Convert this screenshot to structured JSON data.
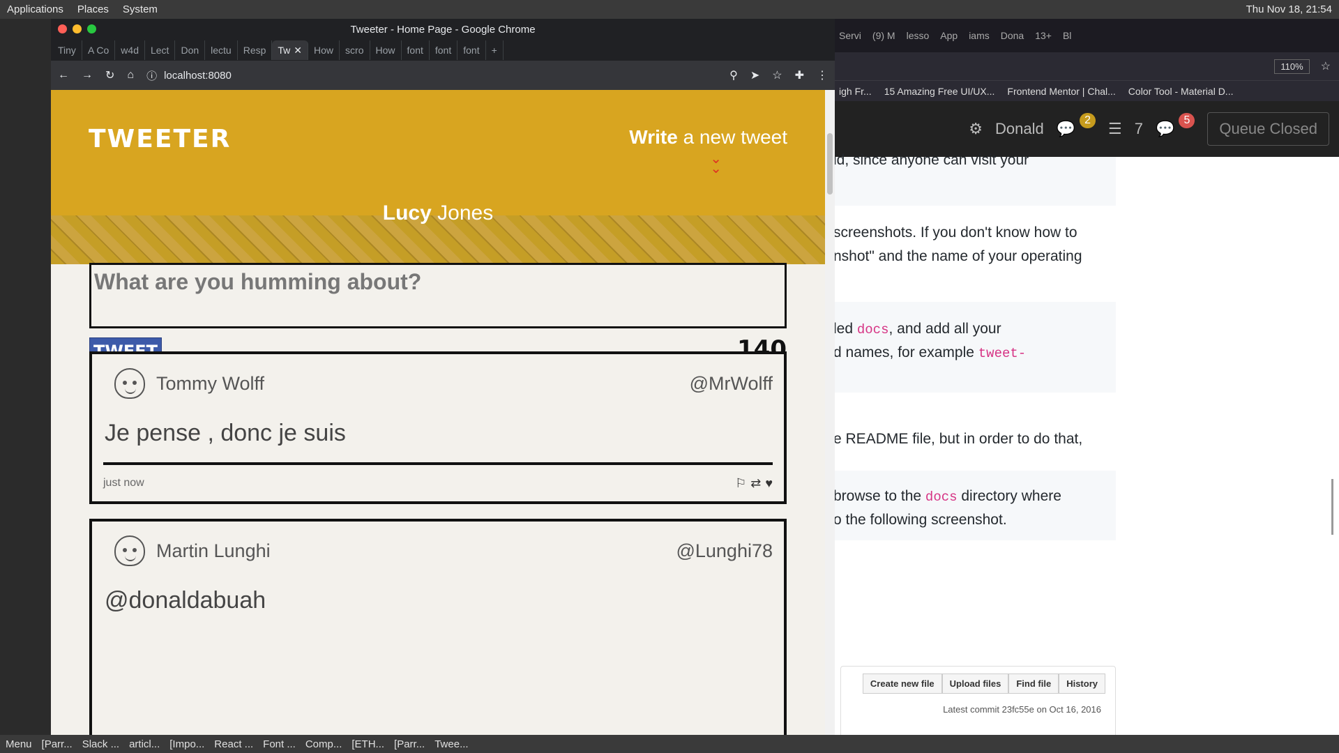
{
  "desktop": {
    "menu_applications": "Applications",
    "menu_places": "Places",
    "menu_system": "System",
    "clock": "Thu Nov 18, 21:54",
    "taskbar_menu": "Menu",
    "taskbar_items": [
      "[Parr...",
      "Slack ...",
      "articl...",
      "[Impo...",
      "React ...",
      "Font ...",
      "Comp...",
      "[ETH...",
      "[Parr...",
      "Twee..."
    ]
  },
  "firefox": {
    "tabs": [
      "Servi",
      "(9) M",
      "lesso",
      "App",
      "iams",
      "Dona",
      "13+",
      "Bl"
    ],
    "zoom": "110%",
    "bookmarks": [
      "igh Fr...",
      "15 Amazing Free UI/UX...",
      "Frontend Mentor | Chal...",
      "Color Tool - Material D..."
    ],
    "header": {
      "user": "Donald",
      "badge_messages": "2",
      "list_count": "7",
      "badge_chat": "5",
      "queue": "Queue Closed"
    },
    "content_lines": [
      "id, since anyone can visit your",
      "screenshots. If you don't know how to",
      "nshot\" and the name of your operating",
      "led",
      "docs",
      ", and add all your",
      "d names, for example",
      "tweet-",
      "e README file, but in order to do that,",
      "browse to the",
      "docs",
      "directory where",
      "o the following screenshot."
    ],
    "gh": {
      "buttons": [
        "Create new file",
        "Upload files",
        "Find file",
        "History"
      ],
      "commit": "Latest commit 23fc55e on Oct 16, 2016"
    }
  },
  "chrome": {
    "window_title": "Tweeter - Home Page - Google Chrome",
    "tabs": [
      "Tiny",
      "A Co",
      "w4d",
      "Lect",
      "Don",
      "lectu",
      "Resp",
      "Tw",
      "How",
      "scro",
      "How",
      "font",
      "font",
      "font"
    ],
    "url": "localhost:8080"
  },
  "page": {
    "logo": "TWEETER",
    "compose_bold": "Write",
    "compose_rest": "a new tweet",
    "profile_first": "Lucy",
    "profile_last": "Jones",
    "placeholder": "What are you humming about?",
    "tweet_button": "TWEET",
    "counter": "140",
    "tweets": [
      {
        "name": "Tommy Wolff",
        "handle": "@MrWolff",
        "text": "Je pense , donc je suis",
        "time": "just now"
      },
      {
        "name": "Martin Lunghi",
        "handle": "@Lunghi78",
        "text": "@donaldabuah"
      }
    ]
  }
}
